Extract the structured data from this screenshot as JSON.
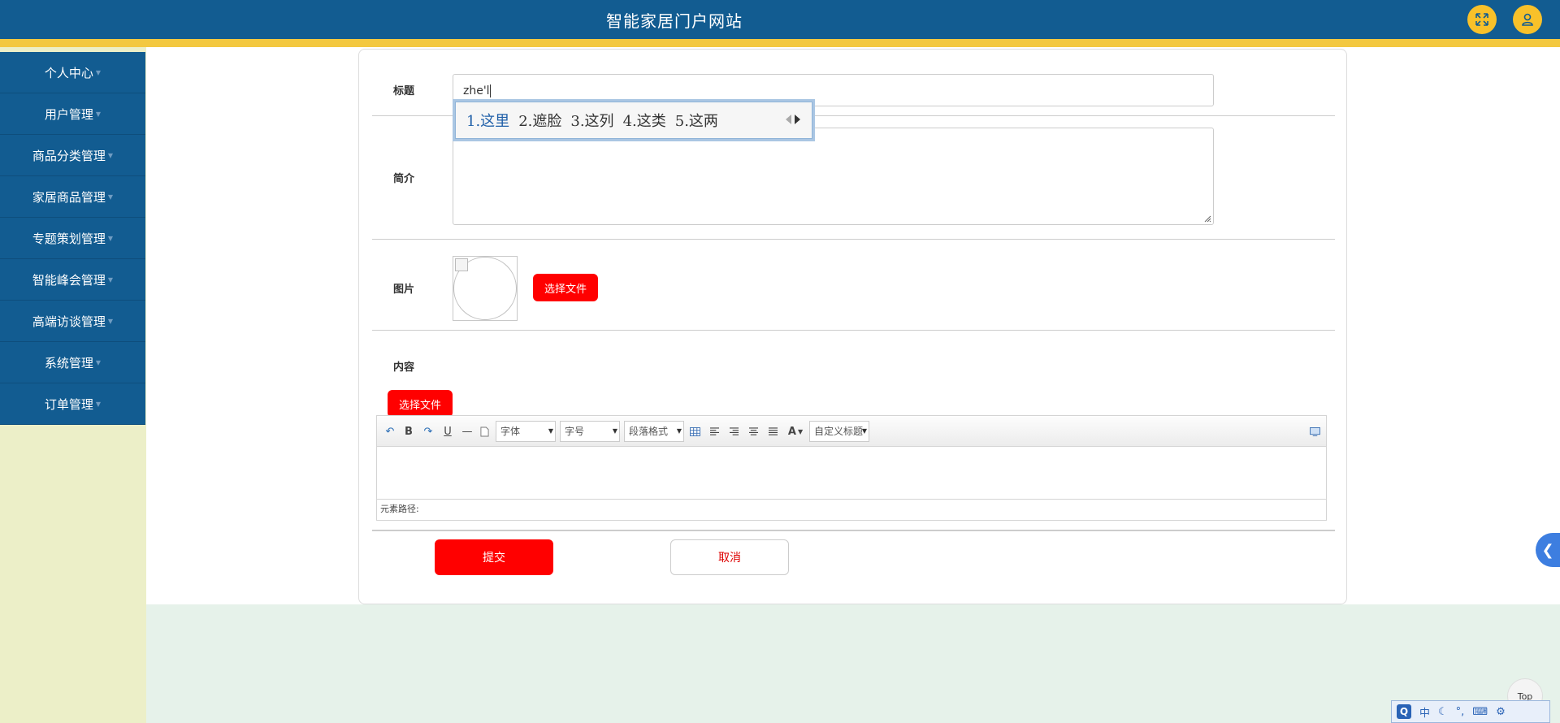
{
  "header": {
    "title": "智能家居门户网站"
  },
  "sidebar": {
    "items": [
      {
        "label": "个人中心"
      },
      {
        "label": "用户管理"
      },
      {
        "label": "商品分类管理"
      },
      {
        "label": "家居商品管理"
      },
      {
        "label": "专题策划管理"
      },
      {
        "label": "智能峰会管理"
      },
      {
        "label": "高端访谈管理"
      },
      {
        "label": "系统管理"
      },
      {
        "label": "订单管理"
      }
    ]
  },
  "form": {
    "title_label": "标题",
    "title_value": "zhe'l",
    "summary_label": "简介",
    "image_label": "图片",
    "select_file_label": "选择文件",
    "content_label": "内容",
    "content_select_file_label": "选择文件",
    "submit_label": "提交",
    "cancel_label": "取消"
  },
  "editor": {
    "font_select": "字体",
    "size_select": "字号",
    "paragraph_select": "段落格式",
    "custom_title_select": "自定义标题",
    "path_label": "元素路径:"
  },
  "ime": {
    "candidates": [
      "1.这里",
      "2.遮脸",
      "3.这列",
      "4.这类",
      "5.这两"
    ]
  },
  "widgets": {
    "side_tab_symbol": "❮",
    "top_label": "Top"
  },
  "ime_bar": {
    "q_label": "Q",
    "mode_label": "中"
  },
  "colors": {
    "header_bg": "#125c91",
    "header_stripe": "#f3c840",
    "accent_red": "#ff0000",
    "sidebar_bg": "#125c91"
  }
}
